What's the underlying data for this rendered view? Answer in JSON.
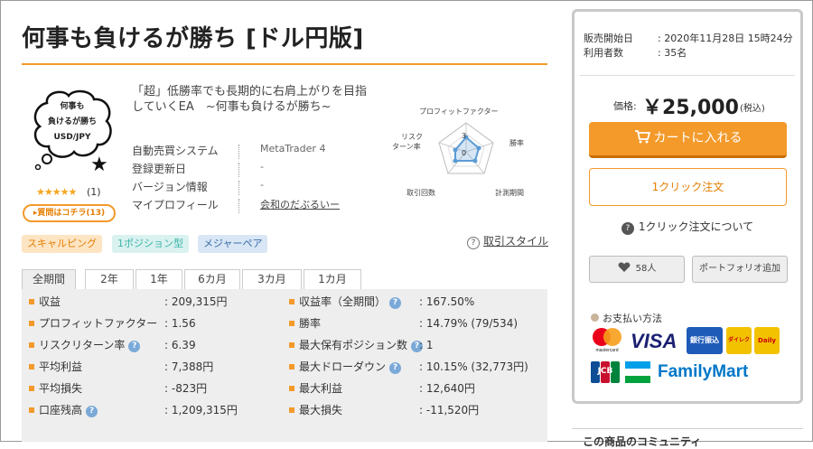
{
  "page": {
    "title": "何事も負けるが勝ち [ドル円版]"
  },
  "product": {
    "bubble_lines": [
      "何事も",
      "負けるが勝ち",
      "USD/JPY"
    ],
    "stars": "★★★★★",
    "review_count": "(1)",
    "question_button": "▸質問はコチラ(13)",
    "description": "「超」低勝率でも長期的に右肩上がりを目指していくEA　~何事も負けるが勝ち~",
    "info": [
      {
        "label": "自動売買システム",
        "value": "MetaTrader 4"
      },
      {
        "label": "登録更新日",
        "value": "-"
      },
      {
        "label": "バージョン情報",
        "value": "-"
      },
      {
        "label": "マイプロフィール",
        "value": "会和のだぶるいー"
      }
    ]
  },
  "radar": {
    "axes": [
      "プロフィットファクター",
      "勝率",
      "計測期間",
      "取引回数",
      "リスク\nターン率"
    ],
    "axis_labels": [
      "プロフィットファクター",
      "勝率",
      "計測期間",
      "取引回数",
      "リスク",
      "ターン率"
    ],
    "scale_labels": [
      "3",
      "0"
    ],
    "color": "#5b9bd5"
  },
  "tags": [
    {
      "label": "スキャルピング",
      "bg": "#fde5c4",
      "fg": "#e67e00"
    },
    {
      "label": "1ポジション型",
      "bg": "#d9f2f0",
      "fg": "#3bb3a8"
    },
    {
      "label": "メジャーペア",
      "bg": "#d9e6f5",
      "fg": "#3a6ea8"
    }
  ],
  "trade_style_link": "取引スタイル",
  "tabs": [
    "全期間",
    "2年",
    "1年",
    "6カ月",
    "3カ月",
    "1カ月"
  ],
  "stats_left": [
    {
      "label": "収益",
      "value": "209,315円",
      "help": false
    },
    {
      "label": "プロフィットファクター",
      "value": "1.56",
      "help": false
    },
    {
      "label": "リスクリターン率",
      "value": "6.39",
      "help": true
    },
    {
      "label": "平均利益",
      "value": "7,388円",
      "help": false
    },
    {
      "label": "平均損失",
      "value": "-823円",
      "help": false
    },
    {
      "label": "口座残高",
      "value": "1,209,315円",
      "help": true
    }
  ],
  "stats_right": [
    {
      "label": "収益率（全期間）",
      "value": "167.50%",
      "help": true
    },
    {
      "label": "勝率",
      "value": "14.79% (79/534)",
      "help": false
    },
    {
      "label": "最大保有ポジション数",
      "value": "1",
      "help": true
    },
    {
      "label": "最大ドローダウン",
      "value": "10.15% (32,773円)",
      "help": true
    },
    {
      "label": "最大利益",
      "value": "12,640円",
      "help": false
    },
    {
      "label": "最大損失",
      "value": "-11,520円",
      "help": false
    }
  ],
  "side": {
    "sale_start_label": "販売開始日",
    "sale_start_value": "2020年11月28日 15時24分",
    "users_label": "利用者数",
    "users_value": "35名",
    "price_label": "価格:",
    "price": "￥25,000",
    "tax": "(税込)",
    "cart": "カートに入れる",
    "oneclick": "1クリック注文",
    "about_oneclick": "1クリック注文について",
    "favorites": "58人",
    "portfolio": "ポートフォリオ追加",
    "payment_label": "お支払い方法",
    "payment_methods": [
      "mastercard",
      "VISA",
      "銀行振込",
      "ダイレクト",
      "Daily",
      "JCB",
      "FamilyMart"
    ],
    "community": "この商品のコミュニティ"
  },
  "colors": {
    "accent": "#f39a2b",
    "stats_bg": "#eeeeee",
    "radar": "#5b9bd5"
  }
}
